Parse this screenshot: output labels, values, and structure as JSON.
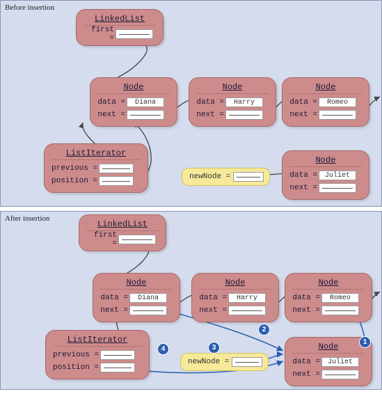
{
  "panels": {
    "before": {
      "label": "Before insertion"
    },
    "after": {
      "label": "After insertion"
    }
  },
  "objects": {
    "linkedList": {
      "title": "LinkedList",
      "first_label": "first ="
    },
    "node": {
      "title": "Node",
      "data_label": "data =",
      "next_label": "next ="
    },
    "iterator": {
      "title": "ListIterator",
      "previous_label": "previous =",
      "position_label": "position ="
    }
  },
  "values": {
    "diana": "Diana",
    "harry": "Harry",
    "romeo": "Romeo",
    "juliet": "Juliet"
  },
  "newNode": {
    "label": "newNode ="
  },
  "steps": {
    "s1": "1",
    "s2": "2",
    "s3": "3",
    "s4": "4"
  }
}
